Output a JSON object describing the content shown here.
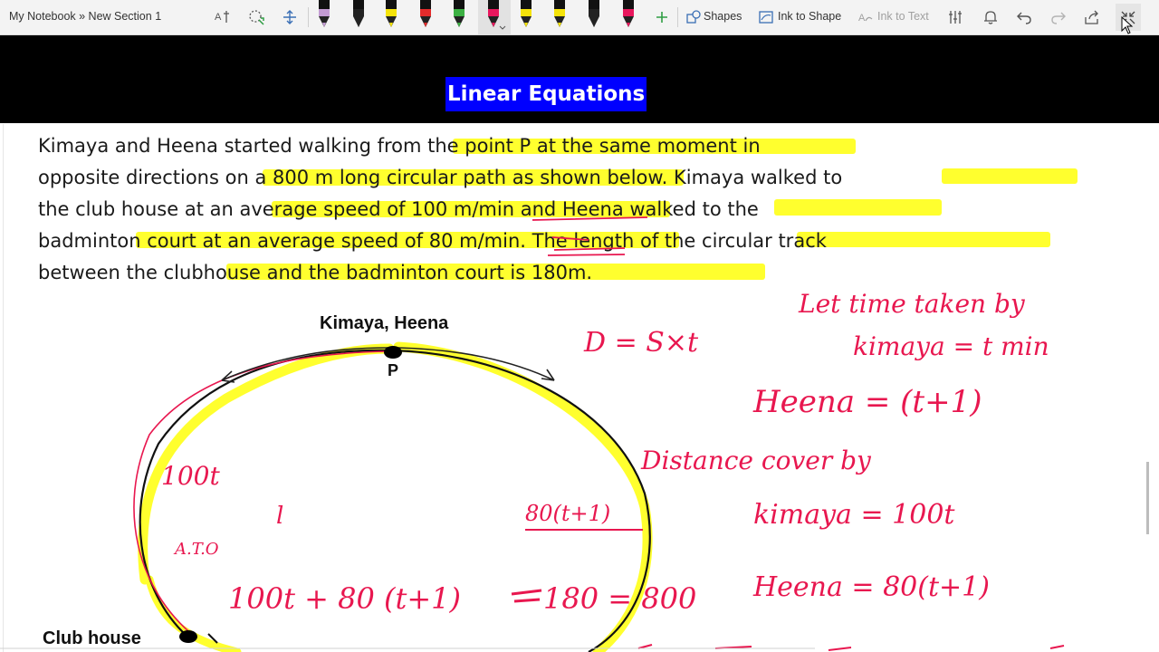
{
  "toolbar": {
    "breadcrumb": "My Notebook » New Section 1",
    "shapes_label": "Shapes",
    "ink_to_shape_label": "Ink to Shape",
    "ink_to_text_label": "Ink to Text",
    "pens": [
      {
        "color": "#c39bd3"
      },
      {
        "color": "#222222"
      },
      {
        "color": "#f5e30a"
      },
      {
        "color": "#e32b2b"
      },
      {
        "color": "#3cb043"
      },
      {
        "color": "#e8175d"
      },
      {
        "color": "#f5e30a"
      },
      {
        "color": "#f5e30a"
      },
      {
        "color": "#222222"
      },
      {
        "color": "#e8175d"
      }
    ]
  },
  "page": {
    "title": "Linear Equations",
    "problem_lines": [
      "Kimaya and Heena started walking from the point P at the same moment in",
      "opposite directions on a 800 m long circular path as shown below. Kimaya walked to",
      "the club house at an average speed of 100 m/min and Heena walked to the",
      "badminton court at an average speed of 80 m/min. The length of the circular track",
      "between the clubhouse and the badminton court is 180m."
    ],
    "diagram": {
      "top_label": "Kimaya, Heena",
      "point_label": "P",
      "club_label": "Club house"
    },
    "handwriting": {
      "formula": "D = S×t",
      "note1": "Let time taken by",
      "note2": "kimaya = t min",
      "note3": "Heena = (t+1)",
      "dist_header": "Distance cover by",
      "dist_kimaya": "kimaya = 100t",
      "dist_heena": "Heena = 80(t+1)",
      "label_100t": "100t",
      "label_80t1": "80(t+1)",
      "label_ato": "A.T.O",
      "label_one": "l",
      "equation_left": "100t + 80 (t+1)",
      "equation_right": "180 = 800"
    }
  },
  "colors": {
    "ink_red": "#e8174f",
    "highlight": "#ffff2e",
    "title_bg": "#0000ff"
  }
}
